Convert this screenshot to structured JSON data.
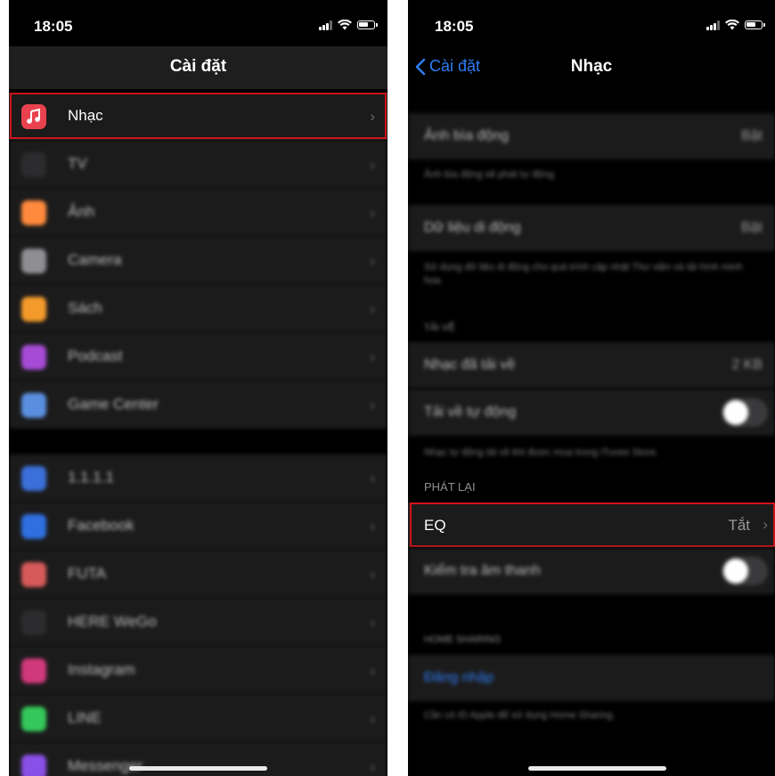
{
  "left": {
    "status": {
      "time": "18:05"
    },
    "nav": {
      "title": "Cài đặt"
    },
    "group1": [
      {
        "label": "Nhạc",
        "icon": "music-note-icon",
        "color": "#e9424f",
        "highlighted": true
      },
      {
        "label": "TV",
        "icon": "appletv-icon",
        "color": "#2c2c2e"
      },
      {
        "label": "Ảnh",
        "icon": "photos-icon",
        "color": "#ff8a3d"
      },
      {
        "label": "Camera",
        "icon": "camera-icon",
        "color": "#8e8e93"
      },
      {
        "label": "Sách",
        "icon": "books-icon",
        "color": "#f39a2b"
      },
      {
        "label": "Podcast",
        "icon": "podcast-icon",
        "color": "#a64bd6"
      },
      {
        "label": "Game Center",
        "icon": "game-center-icon",
        "color": "#5a8fe0"
      }
    ],
    "group2": [
      {
        "label": "1.1.1.1",
        "icon": "app-icon",
        "color": "#3b6fd9"
      },
      {
        "label": "Facebook",
        "icon": "facebook-icon",
        "color": "#2f6fe0"
      },
      {
        "label": "FUTA",
        "icon": "futa-icon",
        "color": "#d65a5a"
      },
      {
        "label": "HERE WeGo",
        "icon": "here-wego-icon",
        "color": "#2c2c2e"
      },
      {
        "label": "Instagram",
        "icon": "instagram-icon",
        "color": "#d0397c"
      },
      {
        "label": "LINE",
        "icon": "line-icon",
        "color": "#34c759"
      },
      {
        "label": "Messenger",
        "icon": "messenger-icon",
        "color": "#8a4fe6"
      }
    ]
  },
  "right": {
    "status": {
      "time": "18:05"
    },
    "nav": {
      "back": "Cài đặt",
      "title": "Nhạc"
    },
    "anim_cover": {
      "label": "Ảnh bìa động",
      "value": "Bật",
      "note": "Ảnh bìa động sẽ phát tự động."
    },
    "cellular": {
      "label": "Dữ liệu di động",
      "value": "Bật",
      "note": "Sử dụng dữ liệu di động cho quá trình cập nhật Thư viện và tải hình minh họa."
    },
    "downloads": {
      "header": "TẢI VỀ",
      "downloaded_label": "Nhạc đã tải về",
      "downloaded_value": "2 KB",
      "auto_label": "Tải về tự động",
      "note": "Nhạc tự động tải về khi được mua trong iTunes Store."
    },
    "playback": {
      "header": "PHÁT LẠI",
      "eq_label": "EQ",
      "eq_value": "Tắt",
      "sound_check_label": "Kiểm tra âm thanh"
    },
    "home_sharing": {
      "header": "HOME SHARING",
      "signin": "Đăng nhập",
      "note": "Cần có ID Apple để sử dụng Home Sharing."
    }
  },
  "colors": {
    "highlight": "#d0121b",
    "link": "#2f7df6"
  }
}
